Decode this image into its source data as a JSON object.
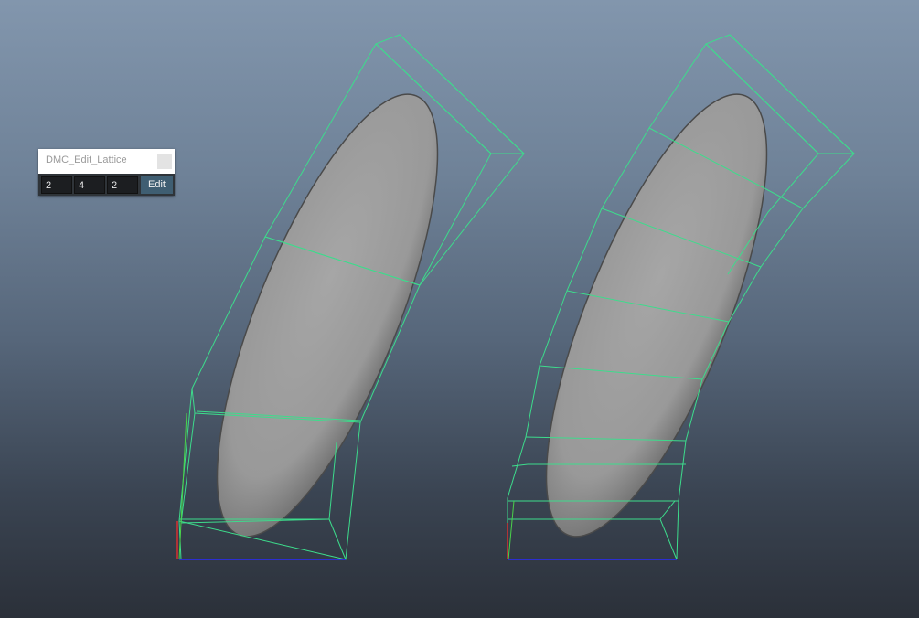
{
  "dialog": {
    "title": "DMC_Edit_Lattice",
    "fields": [
      "2",
      "4",
      "2"
    ],
    "edit_label": "Edit"
  },
  "colors": {
    "lattice": "#3ddc8c",
    "mesh": "#9e9e9e",
    "axis_x": "#2a2aff",
    "axis_y": "#4ad44a",
    "axis_z": "#d83030",
    "edit_button": "#3f5e72"
  }
}
